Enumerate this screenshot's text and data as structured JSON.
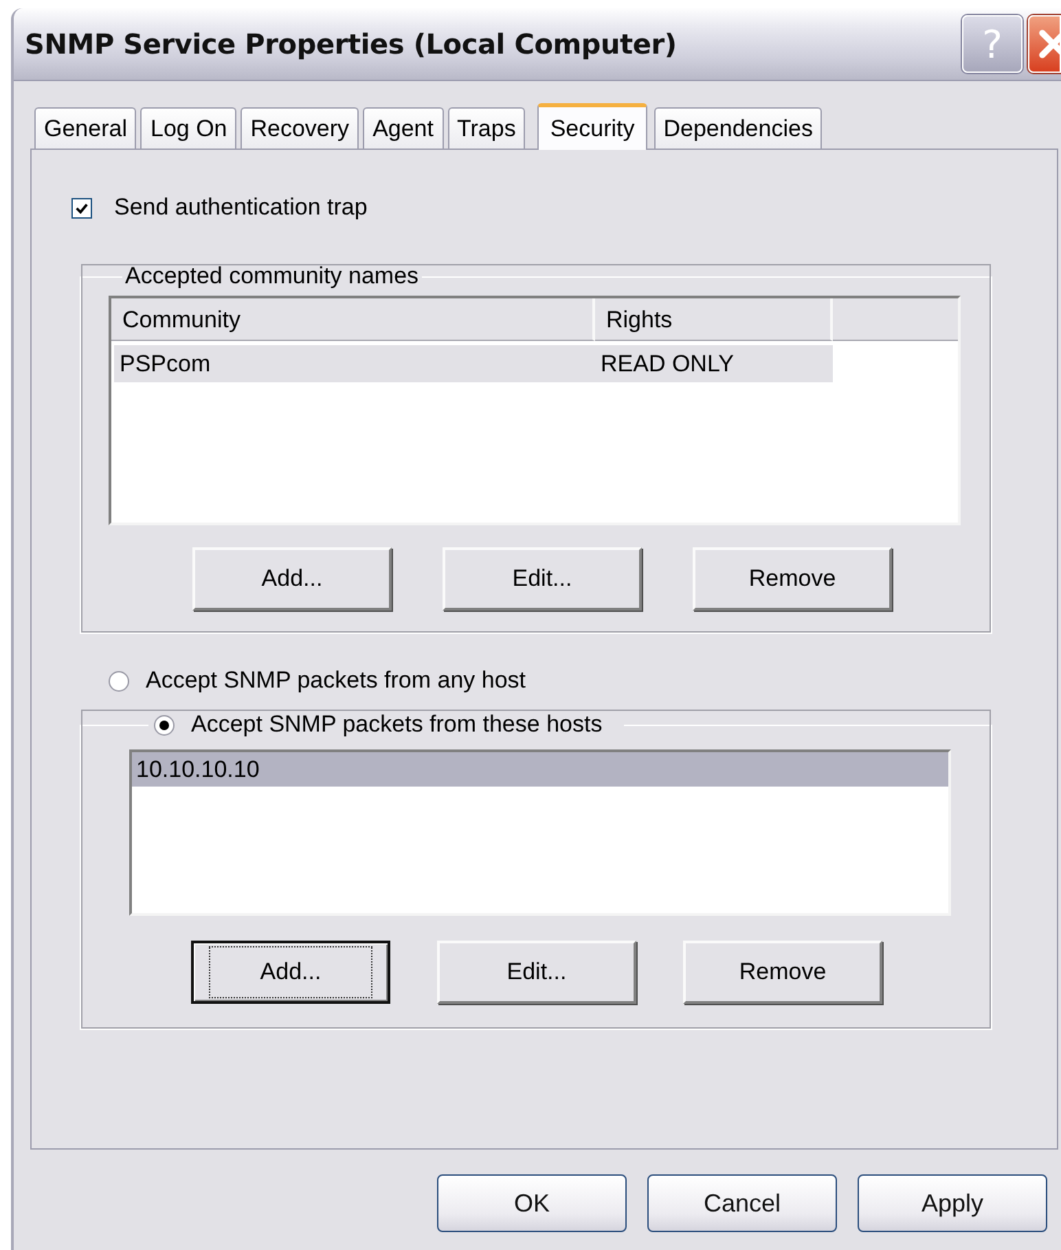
{
  "window": {
    "title": "SNMP Service Properties (Local Computer)",
    "help_button": "?"
  },
  "tabs": [
    {
      "label": "General",
      "selected": false
    },
    {
      "label": "Log On",
      "selected": false
    },
    {
      "label": "Recovery",
      "selected": false
    },
    {
      "label": "Agent",
      "selected": false
    },
    {
      "label": "Traps",
      "selected": false
    },
    {
      "label": "Security",
      "selected": true
    },
    {
      "label": "Dependencies",
      "selected": false
    }
  ],
  "send_auth_trap": {
    "label": "Send authentication trap",
    "checked": true
  },
  "communities": {
    "legend": "Accepted community names",
    "columns": [
      "Community",
      "Rights"
    ],
    "rows": [
      {
        "cells": [
          "PSPcom",
          "READ ONLY"
        ],
        "selected": true
      }
    ],
    "buttons": [
      {
        "label": "Add...",
        "focused": false
      },
      {
        "label": "Edit...",
        "focused": false
      },
      {
        "label": "Remove",
        "focused": false
      }
    ]
  },
  "host_options": [
    {
      "label": "Accept SNMP packets from any host",
      "selected": false
    },
    {
      "label": "Accept SNMP packets from these hosts",
      "selected": true
    }
  ],
  "hosts": {
    "rows": [
      {
        "text": "10.10.10.10",
        "selected": true
      }
    ],
    "buttons": [
      {
        "label": "Add...",
        "focused": true
      },
      {
        "label": "Edit...",
        "focused": false
      },
      {
        "label": "Remove",
        "focused": false
      }
    ]
  },
  "dialog_buttons": [
    "OK",
    "Cancel",
    "Apply"
  ]
}
